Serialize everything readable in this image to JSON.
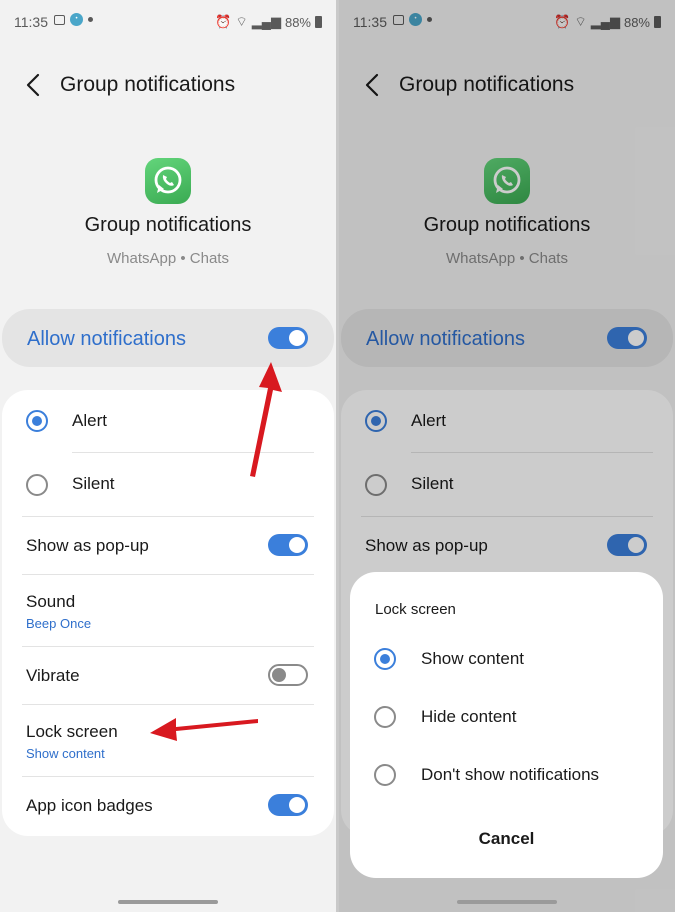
{
  "status_bar": {
    "time": "11:35",
    "battery": "88%"
  },
  "page": {
    "title": "Group notifications"
  },
  "header": {
    "title": "Group notifications",
    "subtitle": "WhatsApp • Chats",
    "app_icon": "whatsapp-icon"
  },
  "allow_notifications": {
    "label": "Allow notifications",
    "value": true
  },
  "settings": {
    "alert_label": "Alert",
    "silent_label": "Silent",
    "selected_mode": "Alert",
    "popup_label": "Show as pop-up",
    "popup_value": true,
    "sound_label": "Sound",
    "sound_value": "Beep Once",
    "vibrate_label": "Vibrate",
    "vibrate_value": false,
    "lock_screen_label": "Lock screen",
    "lock_screen_value": "Show content",
    "badges_label": "App icon badges",
    "badges_value": true
  },
  "lock_screen_dialog": {
    "title": "Lock screen",
    "options": [
      "Show content",
      "Hide content",
      "Don't show notifications"
    ],
    "selected": "Show content",
    "cancel_label": "Cancel"
  },
  "colors": {
    "accent": "#3b7fdb",
    "link": "#2f6fcb",
    "arrow": "#d81920",
    "whatsapp": "#4cc262"
  }
}
